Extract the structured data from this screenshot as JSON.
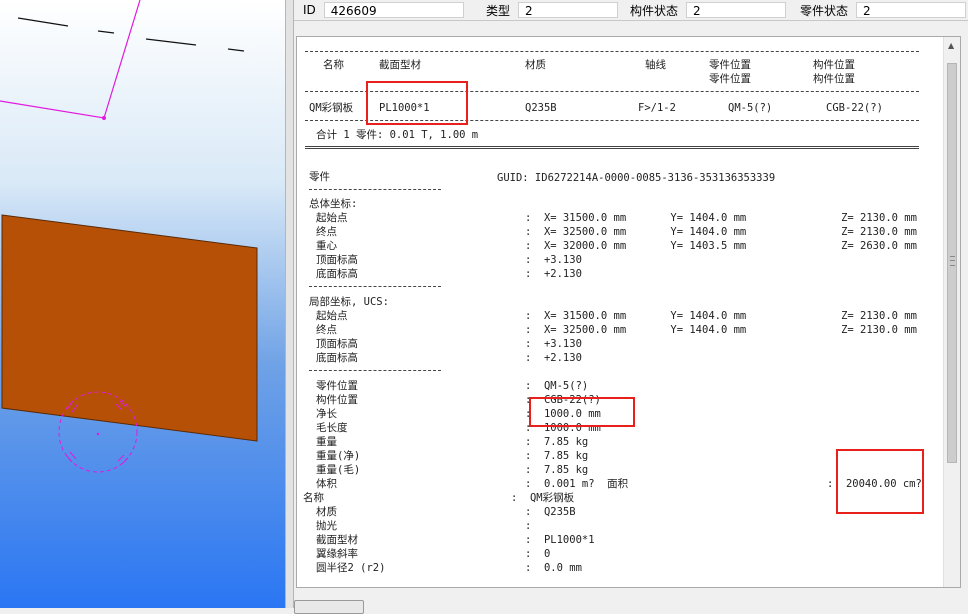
{
  "info_bar": {
    "id_label": "ID",
    "id_value": "426609",
    "type_label": "类型",
    "type_value": "2",
    "assembly_status_label": "构件状态",
    "assembly_status_value": "2",
    "part_status_label": "零件状态",
    "part_status_value": "2"
  },
  "report": {
    "header_name": "名称",
    "header_profile": "截面型材",
    "header_material": "材质",
    "header_axis": "轴线",
    "header_part_pos_1": "零件位置",
    "header_part_pos_2": "零件位置",
    "header_asm_pos_1": "构件位置",
    "header_asm_pos_2": "构件位置",
    "row_name": "QM彩钢板",
    "row_profile": "PL1000*1",
    "row_material": "Q235B",
    "row_axis": "F>/1-2",
    "row_part_pos": "QM-5(?)",
    "row_asm_pos": "CGB-22(?)",
    "total_line": "合计 1 零件: 0.01 T, 1.00 m",
    "part_title": "零件",
    "guid_line": "GUID: ID6272214A-0000-0085-3136-353136353339",
    "global_coords_title": "总体坐标:",
    "global_start_label": "起始点",
    "global_start_value": ":  X= 31500.0 mm       Y= 1404.0 mm               Z= 2130.0 mm",
    "global_end_label": "终点",
    "global_end_value": ":  X= 32500.0 mm       Y= 1404.0 mm               Z= 2130.0 mm",
    "global_cog_label": "重心",
    "global_cog_value": ":  X= 32000.0 mm       Y= 1403.5 mm               Z= 2630.0 mm",
    "global_top_label": "顶面标高",
    "global_top_value": ":  +3.130",
    "global_bottom_label": "底面标高",
    "global_bottom_value": ":  +2.130",
    "local_coords_title": "局部坐标, UCS:",
    "local_start_label": "起始点",
    "local_start_value": ":  X= 31500.0 mm       Y= 1404.0 mm               Z= 2130.0 mm",
    "local_end_label": "终点",
    "local_end_value": ":  X= 32500.0 mm       Y= 1404.0 mm               Z= 2130.0 mm",
    "local_top_label": "顶面标高",
    "local_top_value": ":  +3.130",
    "local_bottom_label": "底面标高",
    "local_bottom_value": ":  +2.130",
    "part_pos_label": "零件位置",
    "part_pos_value": ":  QM-5(?)",
    "asm_pos_label": "构件位置",
    "asm_pos_value": ":  CGB-22(?)",
    "net_length_label": "净长",
    "net_length_value": ":  1000.0 mm",
    "gross_length_label": "毛长度",
    "gross_length_value": ":  1000.0 mm",
    "weight_label": "重量",
    "weight_value": ":  7.85 kg",
    "weight_net_label": "重量(净)",
    "weight_net_value": ":  7.85 kg",
    "weight_gross_label": "重量(毛)",
    "weight_gross_value": ":  7.85 kg",
    "volume_label": "体积",
    "volume_value": ":  0.001 m?  面积",
    "area_value": ":  20040.00 cm?",
    "name_label": "名称",
    "name_value": ":  QM彩钢板",
    "material_label": "材质",
    "material_value": ":  Q235B",
    "finish_label": "抛光",
    "finish_value": ":",
    "profile_label": "截面型材",
    "profile_value": ":  PL1000*1",
    "flange_slope_label": "翼缘斜率",
    "flange_slope_value": ":  0",
    "radius_label": "圆半径2 (r2)",
    "radius_value": ":  0.0 mm"
  },
  "colors": {
    "plate_fill": "#b65007",
    "magenta_line": "#e01ae0",
    "highlight_red": "#e8201c"
  }
}
